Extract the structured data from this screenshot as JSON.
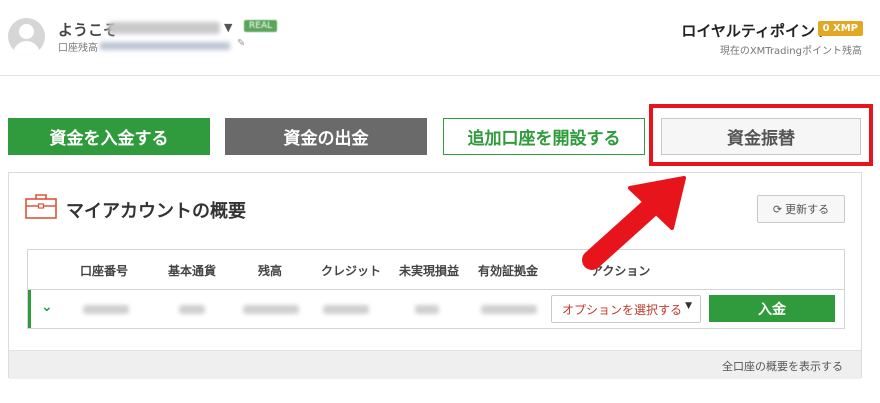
{
  "header": {
    "welcome": "ようこそ",
    "caret_icon": "caret-down-icon",
    "real_badge": "REAL",
    "account_line": "口座残高",
    "loyalty": {
      "title": "ロイヤルティポイント",
      "points_badge": "0 XMP",
      "subtitle": "現在のXMTradingポイント残高"
    }
  },
  "actions": {
    "deposit": "資金を入金する",
    "withdraw": "資金の出金",
    "open_account": "追加口座を開設する",
    "transfer": "資金振替"
  },
  "panel": {
    "title": "マイアカウントの概要",
    "refresh": "更新する",
    "columns": [
      "口座番号",
      "基本通貨",
      "残高",
      "クレジット",
      "未実現損益",
      "有効証拠金",
      "アクション"
    ],
    "row": {
      "option_select": "オプションを選択する",
      "deposit_button": "入金"
    },
    "show_all": "全口座の概要を表示する"
  },
  "colors": {
    "green": "#2f9b3c",
    "gray": "#6a6a6a",
    "highlight_red": "#e8141c",
    "xmp_gold": "#e0a823"
  }
}
